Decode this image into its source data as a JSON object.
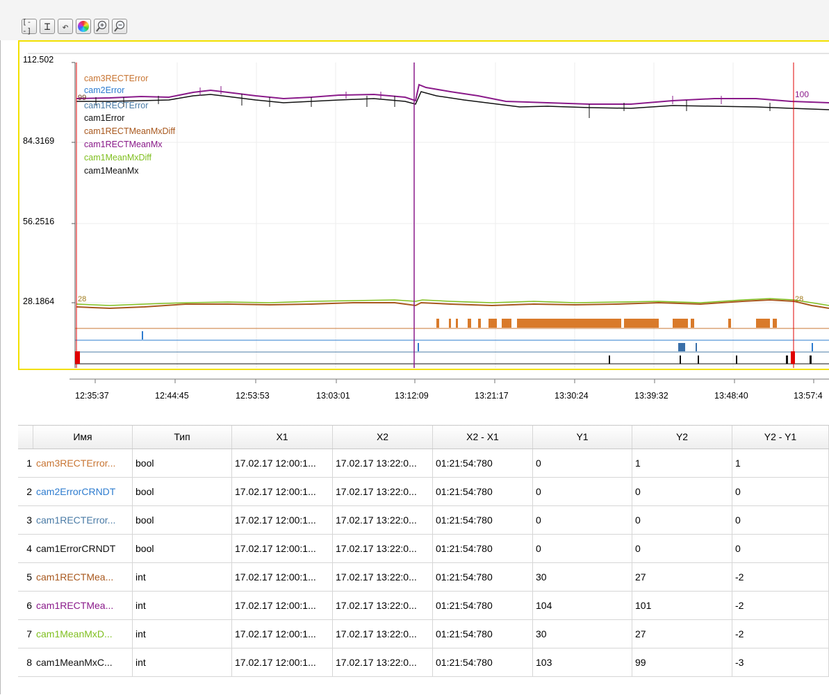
{
  "toolbar": {
    "buttons": [
      {
        "name": "fit-width-button",
        "glyph": "[--]"
      },
      {
        "name": "fit-height-button",
        "glyph": "⌶"
      },
      {
        "name": "undo-button",
        "glyph": "↶"
      },
      {
        "name": "color-wheel-button",
        "glyph": ""
      },
      {
        "name": "zoom-in-button",
        "glyph": "+"
      },
      {
        "name": "zoom-out-button",
        "glyph": "−"
      }
    ]
  },
  "chart": {
    "y_ticks": [
      "112.502",
      "84.3169",
      "56.2516",
      "28.1864"
    ],
    "x_ticks": [
      "12:35:37",
      "12:44:45",
      "12:53:53",
      "13:03:01",
      "13:12:09",
      "13:21:17",
      "13:30:24",
      "13:39:32",
      "13:48:40",
      "13:57:4"
    ],
    "legend": [
      {
        "label": "cam3RECTError",
        "color": "#c87533"
      },
      {
        "label": "cam2Error",
        "color": "#2e7ccf"
      },
      {
        "label": "cam1RECTError",
        "color": "#4a7ba6"
      },
      {
        "label": "cam1Error",
        "color": "#111111"
      },
      {
        "label": "cam1RECTMeanMxDiff",
        "color": "#a8581e"
      },
      {
        "label": "cam1RECTMeanMx",
        "color": "#8a1a8a"
      },
      {
        "label": "cam1MeanMxDiff",
        "color": "#7fbf1f"
      },
      {
        "label": "cam1MeanMx",
        "color": "#111111"
      }
    ],
    "cursor_labels": {
      "left_top": "99",
      "right_top": "100",
      "left_low": "28",
      "right_low": "28"
    }
  },
  "table": {
    "headers": [
      "Имя",
      "Тип",
      "X1",
      "X2",
      "X2 - X1",
      "Y1",
      "Y2",
      "Y2 - Y1"
    ],
    "rows": [
      {
        "num": "1",
        "name": "cam3RECTError...",
        "color": "#c87533",
        "type": "bool",
        "x1": "17.02.17 12:00:1...",
        "x2": "17.02.17 13:22:0...",
        "dx": "01:21:54:780",
        "y1": "0",
        "y2": "1",
        "dy": "1"
      },
      {
        "num": "2",
        "name": "cam2ErrorCRNDT",
        "color": "#2e7ccf",
        "type": "bool",
        "x1": "17.02.17 12:00:1...",
        "x2": "17.02.17 13:22:0...",
        "dx": "01:21:54:780",
        "y1": "0",
        "y2": "0",
        "dy": "0"
      },
      {
        "num": "3",
        "name": "cam1RECTError...",
        "color": "#4a7ba6",
        "type": "bool",
        "x1": "17.02.17 12:00:1...",
        "x2": "17.02.17 13:22:0...",
        "dx": "01:21:54:780",
        "y1": "0",
        "y2": "0",
        "dy": "0"
      },
      {
        "num": "4",
        "name": "cam1ErrorCRNDT",
        "color": "#111111",
        "type": "bool",
        "x1": "17.02.17 12:00:1...",
        "x2": "17.02.17 13:22:0...",
        "dx": "01:21:54:780",
        "y1": "0",
        "y2": "0",
        "dy": "0"
      },
      {
        "num": "5",
        "name": "cam1RECTMea...",
        "color": "#a8581e",
        "type": "int",
        "x1": "17.02.17 12:00:1...",
        "x2": "17.02.17 13:22:0...",
        "dx": "01:21:54:780",
        "y1": "30",
        "y2": "27",
        "dy": "-2"
      },
      {
        "num": "6",
        "name": "cam1RECTMea...",
        "color": "#8a1a8a",
        "type": "int",
        "x1": "17.02.17 12:00:1...",
        "x2": "17.02.17 13:22:0...",
        "dx": "01:21:54:780",
        "y1": "104",
        "y2": "101",
        "dy": "-2"
      },
      {
        "num": "7",
        "name": "cam1MeanMxD...",
        "color": "#7fbf1f",
        "type": "int",
        "x1": "17.02.17 12:00:1...",
        "x2": "17.02.17 13:22:0...",
        "dx": "01:21:54:780",
        "y1": "30",
        "y2": "27",
        "dy": "-2"
      },
      {
        "num": "8",
        "name": "cam1MeanMxC...",
        "color": "#111111",
        "type": "int",
        "x1": "17.02.17 12:00:1...",
        "x2": "17.02.17 13:22:0...",
        "dx": "01:21:54:780",
        "y1": "103",
        "y2": "99",
        "dy": "-3"
      }
    ]
  }
}
